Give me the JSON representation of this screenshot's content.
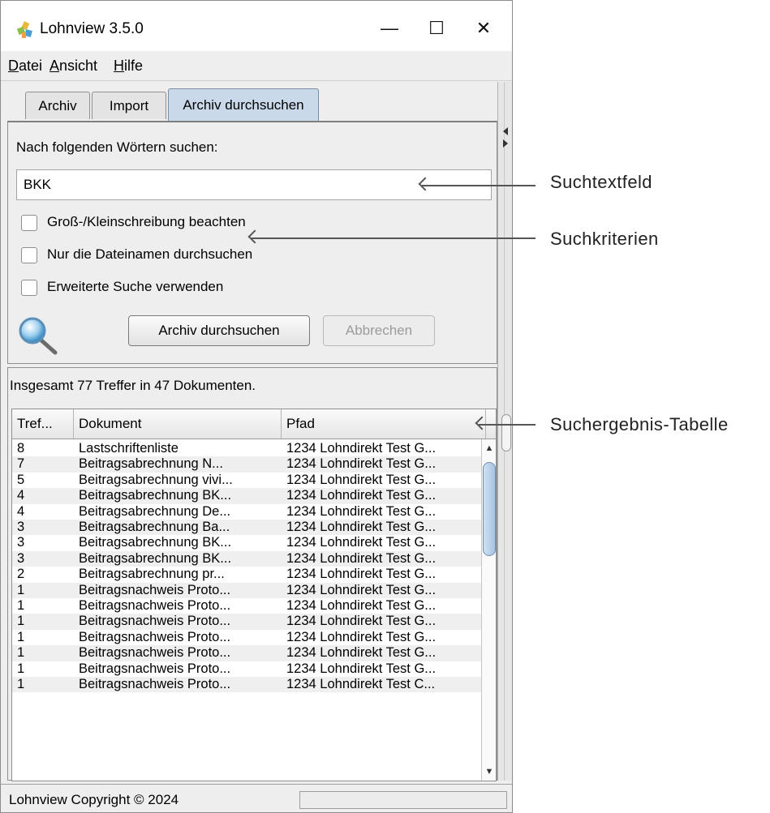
{
  "window": {
    "title": "Lohnview 3.5.0",
    "controls": {
      "minimize": "—",
      "maximize": "☐",
      "close": "✕"
    }
  },
  "menu": {
    "items": [
      {
        "first": "D",
        "rest": "atei"
      },
      {
        "first": "A",
        "rest": "nsicht"
      },
      {
        "first": "H",
        "rest": "ilfe"
      }
    ]
  },
  "tabs": [
    "Archiv",
    "Import",
    "Archiv durchsuchen"
  ],
  "search": {
    "prompt": "Nach folgenden Wörtern suchen:",
    "value": "BKK",
    "options": [
      "Groß-/Kleinschreibung beachten",
      "Nur die Dateinamen durchsuchen",
      "Erweiterte Suche verwenden"
    ],
    "search_button": "Archiv durchsuchen",
    "cancel_button": "Abbrechen"
  },
  "results": {
    "summary": "Insgesamt 77 Treffer in 47 Dokumenten.",
    "columns": [
      "Tref...",
      "Dokument",
      "Pfad"
    ],
    "rows": [
      [
        "8",
        "Lastschriftenliste",
        "1234 Lohndirekt Test G..."
      ],
      [
        "7",
        "Beitragsabrechnung N...",
        "1234 Lohndirekt Test G..."
      ],
      [
        "5",
        "Beitragsabrechnung vivi...",
        "1234 Lohndirekt Test G..."
      ],
      [
        "4",
        "Beitragsabrechnung BK...",
        "1234 Lohndirekt Test G..."
      ],
      [
        "4",
        "Beitragsabrechnung De...",
        "1234 Lohndirekt Test G..."
      ],
      [
        "3",
        "Beitragsabrechnung Ba...",
        "1234 Lohndirekt Test G..."
      ],
      [
        "3",
        "Beitragsabrechnung BK...",
        "1234 Lohndirekt Test G..."
      ],
      [
        "3",
        "Beitragsabrechnung BK...",
        "1234 Lohndirekt Test G..."
      ],
      [
        "2",
        "Beitragsabrechnung pr...",
        "1234 Lohndirekt Test G..."
      ],
      [
        "1",
        "Beitragsnachweis Proto...",
        "1234 Lohndirekt Test G..."
      ],
      [
        "1",
        "Beitragsnachweis Proto...",
        "1234 Lohndirekt Test G..."
      ],
      [
        "1",
        "Beitragsnachweis Proto...",
        "1234 Lohndirekt Test G..."
      ],
      [
        "1",
        "Beitragsnachweis Proto...",
        "1234 Lohndirekt Test G..."
      ],
      [
        "1",
        "Beitragsnachweis Proto...",
        "1234 Lohndirekt Test G..."
      ],
      [
        "1",
        "Beitragsnachweis Proto...",
        "1234 Lohndirekt Test G..."
      ],
      [
        "1",
        "Beitragsnachweis Proto...",
        "1234 Lohndirekt Test C..."
      ]
    ]
  },
  "statusbar": {
    "text": "Lohnview Copyright © 2024"
  },
  "callouts": {
    "textfield": "Suchtextfeld",
    "criteria": "Suchkriterien",
    "table": "Suchergebnis-Tabelle"
  },
  "icons": {
    "app": "lohnview-app-icon",
    "search": "magnifier-icon"
  }
}
